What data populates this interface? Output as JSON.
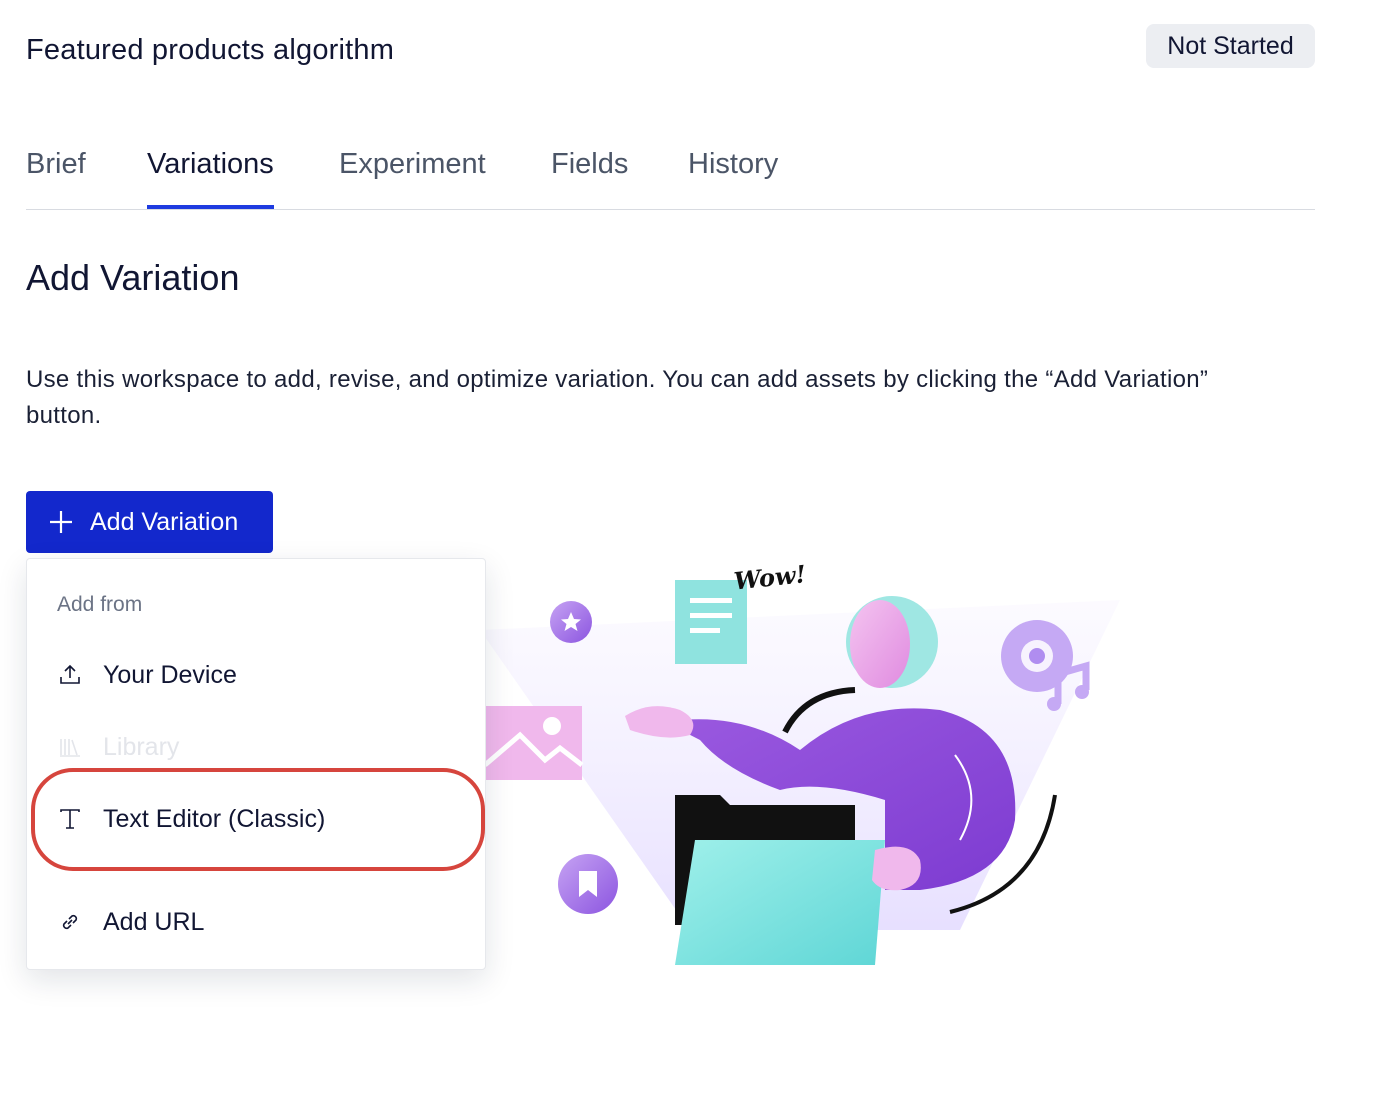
{
  "header": {
    "title": "Featured products algorithm",
    "status": "Not Started"
  },
  "tabs": [
    {
      "label": "Brief",
      "active": false
    },
    {
      "label": "Variations",
      "active": true
    },
    {
      "label": "Experiment",
      "active": false
    },
    {
      "label": "Fields",
      "active": false
    },
    {
      "label": "History",
      "active": false
    }
  ],
  "main": {
    "section_title": "Add Variation",
    "description": "Use this workspace to add, revise, and optimize variation. You can add assets by clicking the “Add Variation” button.",
    "add_button_label": "Add Variation"
  },
  "dropdown": {
    "header": "Add from",
    "items": [
      {
        "label": "Your Device",
        "icon": "upload-icon",
        "disabled": false
      },
      {
        "label": "Library",
        "icon": "library-icon",
        "disabled": true
      },
      {
        "label": "Text Editor (Classic)",
        "icon": "text-icon",
        "disabled": false,
        "highlighted": true
      },
      {
        "label": "Add URL",
        "icon": "link-icon",
        "disabled": false
      }
    ]
  },
  "illustration": {
    "speech_text": "Wow!"
  },
  "colors": {
    "primary": "#1328cc",
    "tab_active_underline": "#1e3be0",
    "badge_bg": "#eceef2",
    "highlight": "#d6453d"
  }
}
